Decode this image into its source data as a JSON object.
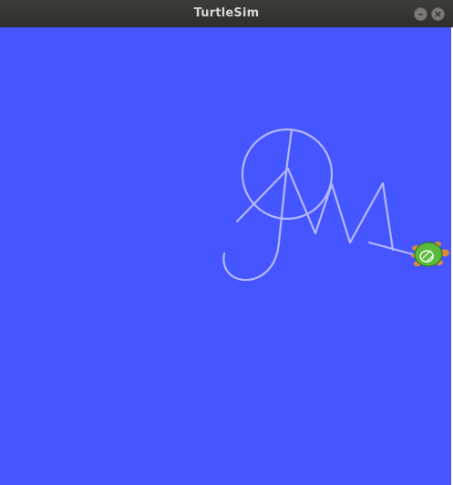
{
  "window": {
    "title": "TurtleSim",
    "minimize_glyph": "–",
    "close_glyph": "×"
  },
  "canvas": {
    "background_color": "#4555ff",
    "pen_color": "#b3b8ff"
  },
  "turtle": {
    "shell_color": "#5aba3b",
    "skin_color": "#e0873b",
    "icon": "turtle-icon"
  }
}
